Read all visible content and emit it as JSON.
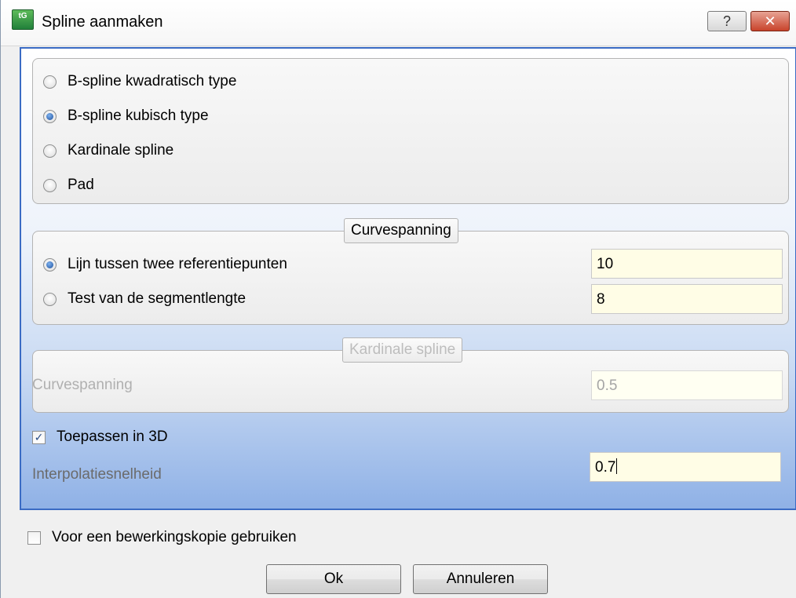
{
  "window": {
    "title": "Spline aanmaken",
    "app_icon_text": "tG",
    "help_label": "?",
    "close_label": "✕"
  },
  "spline_type": {
    "options": [
      {
        "label": "B-spline kwadratisch type",
        "selected": false
      },
      {
        "label": "B-spline kubisch type",
        "selected": true
      },
      {
        "label": "Kardinale spline",
        "selected": false
      },
      {
        "label": "Pad",
        "selected": false
      }
    ]
  },
  "curvespanning_group": {
    "legend": "Curvespanning",
    "options": [
      {
        "label": "Lijn tussen twee referentiepunten",
        "selected": true,
        "value": "10"
      },
      {
        "label": "Test van de segmentlengte",
        "selected": false,
        "value": "8"
      }
    ]
  },
  "kardinale_group": {
    "legend": "Kardinale spline",
    "label": "Curvespanning",
    "value": "0.5",
    "enabled": false
  },
  "apply_3d": {
    "label": "Toepassen in 3D",
    "checked": true,
    "check_glyph": "✓"
  },
  "interpolation": {
    "label": "Interpolatiesnelheid",
    "value": "0.7"
  },
  "copy_option": {
    "label": "Voor een bewerkingskopie gebruiken",
    "checked": false
  },
  "buttons": {
    "ok": "Ok",
    "cancel": "Annuleren"
  },
  "colors": {
    "panel_border": "#3a6bc4",
    "field_background": "#fffde6",
    "close_button": "#c8432b"
  }
}
